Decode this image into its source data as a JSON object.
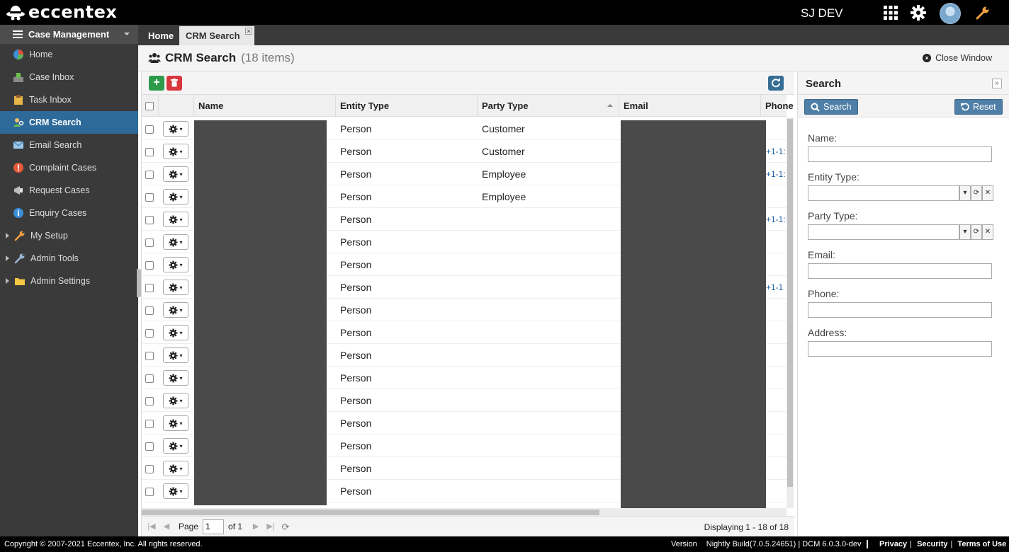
{
  "app": {
    "brand": "eccentex",
    "user": "SJ DEV"
  },
  "sidebar": {
    "title": "Case Management",
    "items": [
      {
        "label": "Home",
        "icon": "pie-chart-icon"
      },
      {
        "label": "Case Inbox",
        "icon": "inbox-tray-icon"
      },
      {
        "label": "Task Inbox",
        "icon": "clipboard-icon"
      },
      {
        "label": "CRM Search",
        "icon": "people-search-icon"
      },
      {
        "label": "Email Search",
        "icon": "envelope-icon"
      },
      {
        "label": "Complaint Cases",
        "icon": "warning-circle-icon"
      },
      {
        "label": "Request Cases",
        "icon": "megaphone-icon"
      },
      {
        "label": "Enquiry Cases",
        "icon": "info-icon"
      },
      {
        "label": "My Setup",
        "icon": "wrench-icon"
      },
      {
        "label": "Admin Tools",
        "icon": "tools-icon"
      },
      {
        "label": "Admin Settings",
        "icon": "folder-icon"
      }
    ]
  },
  "tabs": [
    {
      "label": "Home"
    },
    {
      "label": "CRM Search"
    }
  ],
  "page": {
    "title": "CRM Search",
    "count": "(18 items)",
    "close_label": "Close Window"
  },
  "grid": {
    "columns": [
      "Name",
      "Entity Type",
      "Party Type",
      "Email",
      "Phone"
    ],
    "rows": [
      {
        "entity": "Person",
        "party": "Customer",
        "phone": ""
      },
      {
        "entity": "Person",
        "party": "Customer",
        "phone": "+1-1:"
      },
      {
        "entity": "Person",
        "party": "Employee",
        "phone": "+1-1:"
      },
      {
        "entity": "Person",
        "party": "Employee",
        "phone": ""
      },
      {
        "entity": "Person",
        "party": "",
        "phone": "+1-1:"
      },
      {
        "entity": "Person",
        "party": "",
        "phone": ""
      },
      {
        "entity": "Person",
        "party": "",
        "phone": ""
      },
      {
        "entity": "Person",
        "party": "",
        "phone": "+1-1"
      },
      {
        "entity": "Person",
        "party": "",
        "phone": ""
      },
      {
        "entity": "Person",
        "party": "",
        "phone": ""
      },
      {
        "entity": "Person",
        "party": "",
        "phone": ""
      },
      {
        "entity": "Person",
        "party": "",
        "phone": ""
      },
      {
        "entity": "Person",
        "party": "",
        "phone": ""
      },
      {
        "entity": "Person",
        "party": "",
        "phone": ""
      },
      {
        "entity": "Person",
        "party": "",
        "phone": ""
      },
      {
        "entity": "Person",
        "party": "",
        "phone": ""
      },
      {
        "entity": "Person",
        "party": "",
        "phone": ""
      }
    ]
  },
  "pager": {
    "page_label": "Page",
    "page_value": "1",
    "of_label": "of 1",
    "display": "Displaying 1 - 18 of 18"
  },
  "search": {
    "title": "Search",
    "search_btn": "Search",
    "reset_btn": "Reset",
    "fields": [
      {
        "label": "Name:"
      },
      {
        "label": "Entity Type:"
      },
      {
        "label": "Party Type:"
      },
      {
        "label": "Email:"
      },
      {
        "label": "Phone:"
      },
      {
        "label": "Address:"
      }
    ]
  },
  "footer": {
    "copyright": "Copyright © 2007-2021 Eccentex, Inc. All rights reserved.",
    "version_label": "Version",
    "version": "Nightly Build(7.0.5.24651) | DCM 6.0.3.0-dev",
    "links": [
      "Privacy",
      "Security",
      "Terms of Use"
    ]
  },
  "colors": {
    "accent": "#2d6a9a",
    "add": "#2e9b4b",
    "delete": "#d9363e"
  }
}
